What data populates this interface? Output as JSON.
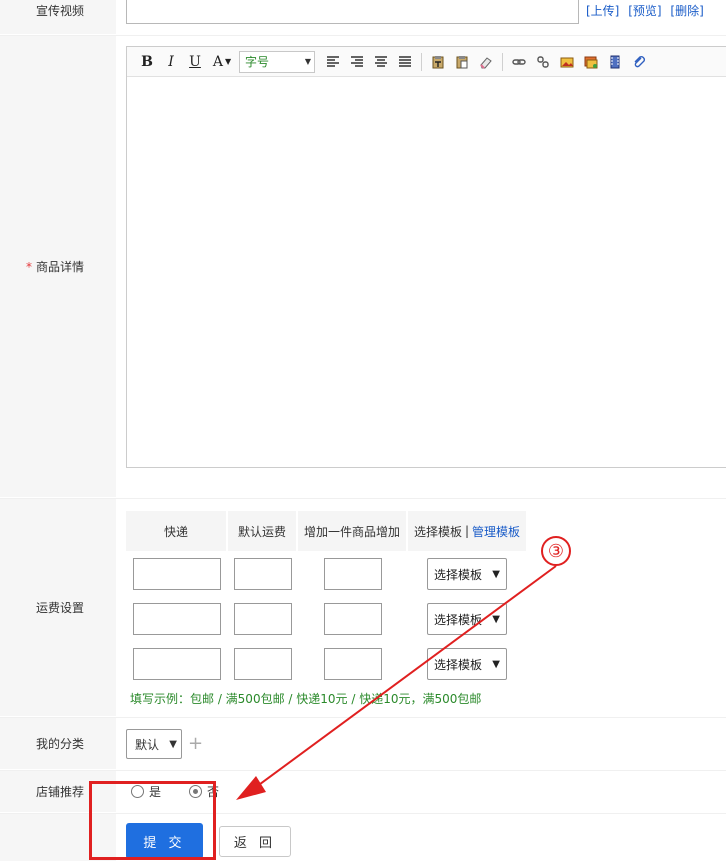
{
  "form": {
    "video_label": "宣传视频",
    "video_links": [
      "[上传]",
      "[预览]",
      "[删除]"
    ],
    "detail_label": "商品详情",
    "detail_required": "*",
    "shipping_label": "运费设置",
    "category_label": "我的分类",
    "recommend_label": "店铺推荐"
  },
  "editor": {
    "bold": "B",
    "italic": "I",
    "underline": "U",
    "font_color": "A",
    "font_size_placeholder": "字号"
  },
  "shipping": {
    "headers": [
      "快递",
      "默认运费",
      "增加一件商品增加",
      "选择模板",
      "管理模板"
    ],
    "header_sep": "|",
    "rows": [
      {
        "template": "选择模板"
      },
      {
        "template": "选择模板"
      },
      {
        "template": "选择模板"
      }
    ],
    "hint": "填写示例：包邮 / 满500包邮 / 快递10元 / 快递10元，满500包邮"
  },
  "category": {
    "selected": "默认",
    "add": "+"
  },
  "recommend": {
    "yes": "是",
    "no": "否",
    "selected": "否"
  },
  "actions": {
    "submit": "提 交",
    "back": "返 回"
  },
  "annotation": {
    "step": "③",
    "color": "#e02020"
  },
  "colors": {
    "primary": "#1f6fe0",
    "link": "#1a5cc8",
    "hint": "#2b8a2b",
    "required": "#e4393c"
  }
}
